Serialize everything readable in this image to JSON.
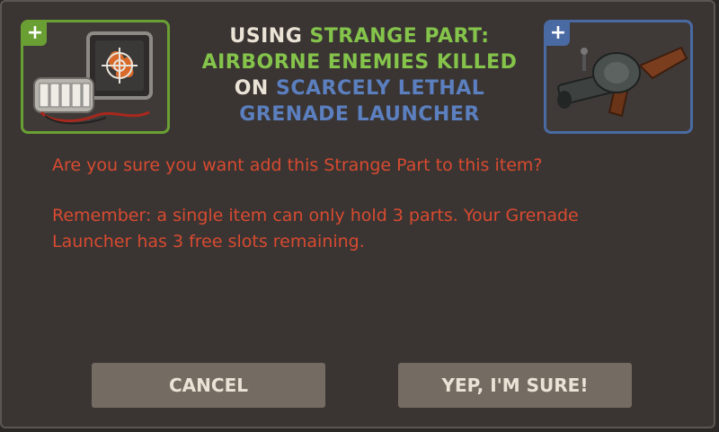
{
  "title": {
    "line1_prefix": "USING",
    "line1_part": "STRANGE PART:",
    "line2_part_name": "AIRBORNE ENEMIES KILLED",
    "line3_prefix": "ON",
    "line3_item": "SCARCELY LETHAL",
    "line4_item": "GRENADE LAUNCHER"
  },
  "left_item": {
    "plus_label": "+",
    "icon": "strange-part-airborne-enemies-killed-icon",
    "border_color": "#6aa033"
  },
  "right_item": {
    "plus_label": "+",
    "icon": "grenade-launcher-icon",
    "border_color": "#4a6aa3"
  },
  "message": {
    "question": "Are you sure you want add this Strange Part to this item?",
    "reminder": "Remember: a single item can only hold 3 parts. Your Grenade Launcher has 3 free slots remaining."
  },
  "buttons": {
    "cancel_label": "CANCEL",
    "confirm_label": "YEP, I'M SURE!"
  },
  "colors": {
    "warning_text": "#d84a30",
    "strange_green": "#85c44b",
    "unique_blue": "#5b7fbf",
    "button_bg": "#746b62"
  }
}
